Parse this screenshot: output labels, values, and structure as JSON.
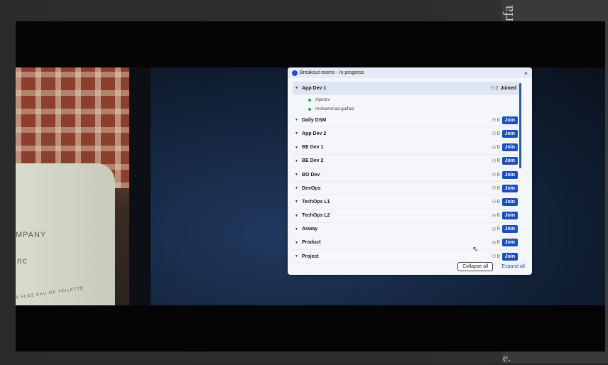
{
  "background_side_text": {
    "top": "rfa",
    "bottom": "e."
  },
  "bottle": {
    "line1": "MPANY",
    "line2": "nc",
    "line3": "4 FLOZ EAU DE TOILETTE"
  },
  "window": {
    "title": "Breakout rooms - In progress",
    "close_icon": "×"
  },
  "rooms": [
    {
      "name": "App Dev 1",
      "count": "2",
      "status": "Joined",
      "expanded": true,
      "members": [
        "Apoorv",
        "mohammad.gulfaiz"
      ]
    },
    {
      "name": "Daily DSM",
      "count": "0",
      "status": "Join"
    },
    {
      "name": "App Dev 2",
      "count": "0",
      "status": "Join"
    },
    {
      "name": "BE Dev 1",
      "count": "0",
      "status": "Join"
    },
    {
      "name": "BE Dev 2",
      "count": "0",
      "status": "Join"
    },
    {
      "name": "BO Dev",
      "count": "0",
      "status": "Join"
    },
    {
      "name": "DevOps",
      "count": "0",
      "status": "Join"
    },
    {
      "name": "TechOps L1",
      "count": "0",
      "status": "Join"
    },
    {
      "name": "TechOps L2",
      "count": "0",
      "status": "Join"
    },
    {
      "name": "Axway",
      "count": "0",
      "status": "Join"
    },
    {
      "name": "Product",
      "count": "0",
      "status": "Join"
    },
    {
      "name": "Project",
      "count": "0",
      "status": "Join"
    }
  ],
  "footer": {
    "collapse_label": "Collapse all",
    "expand_label": "Expand all"
  },
  "colors": {
    "accent": "#1a4fbf",
    "member_dot": "#2ea44f"
  }
}
